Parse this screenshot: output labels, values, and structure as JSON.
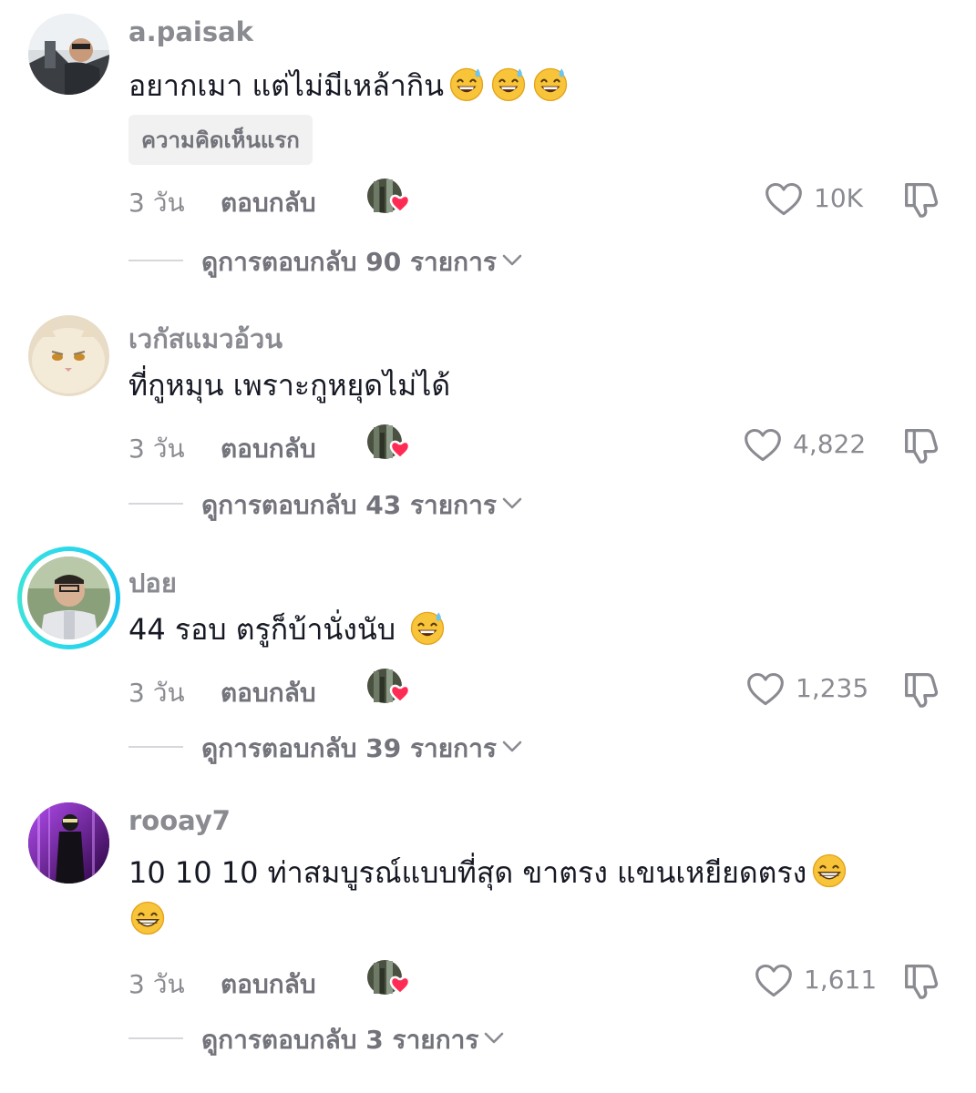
{
  "comments": [
    {
      "username": "a.paisak",
      "text": "อยากเมา แต่ไม่มีเหล้ากิน",
      "emoji_trailing": [
        "sweat-smile-emoji",
        "sweat-smile-emoji",
        "sweat-smile-emoji"
      ],
      "tag": "ความคิดเห็นแรก",
      "time": "3 วัน",
      "reply_label": "ตอบกลับ",
      "likes": "10K",
      "view_replies": "ดูการตอบกลับ 90 รายการ"
    },
    {
      "username": "เวกัสแมวอ้วน",
      "text": "ที่กูหมุน เพราะกูหยุดไม่ได้",
      "time": "3 วัน",
      "reply_label": "ตอบกลับ",
      "likes": "4,822",
      "view_replies": "ดูการตอบกลับ 43 รายการ"
    },
    {
      "username": "ปอย",
      "text": "44 รอบ ตรูก็บ้านั่งนับ ",
      "emoji_trailing": [
        "sweat-smile-emoji"
      ],
      "time": "3 วัน",
      "reply_label": "ตอบกลับ",
      "likes": "1,235",
      "view_replies": "ดูการตอบกลับ 39 รายการ"
    },
    {
      "username": "rooay7",
      "text": "10 10 10 ท่าสมบูรณ์แบบที่สุด ขาตรง แขนเหยียดตรง",
      "emoji_trailing": [
        "grin-emoji",
        "grin-emoji"
      ],
      "time": "3 วัน",
      "reply_label": "ตอบกลับ",
      "likes": "1,611",
      "view_replies": "ดูการตอบกลับ 3 รายการ"
    }
  ],
  "colors": {
    "secondary_text": "#8a8b91",
    "primary_text": "#161823",
    "heart_red": "#fe2c55",
    "story_ring": "#2bd9ea"
  }
}
